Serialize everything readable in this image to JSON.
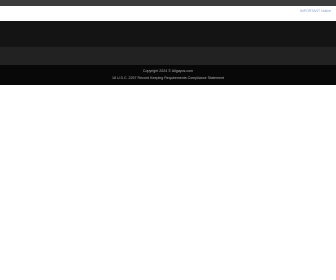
{
  "header": {
    "link_label": "IMPORTANT Notice"
  },
  "footer": {
    "copyright": "Copyright 2024 © Allgayos.com",
    "usc_label": "18 U.S.C. 2257 Record Keeping Requirements Compliance Statement"
  },
  "colors": {
    "top_bar": "#3c3c3c",
    "nav_band": "#141414",
    "sub_band": "#222222",
    "footer_bg": "#080808",
    "footer_text": "#b0b0b0",
    "link": "#8aa0c8"
  }
}
